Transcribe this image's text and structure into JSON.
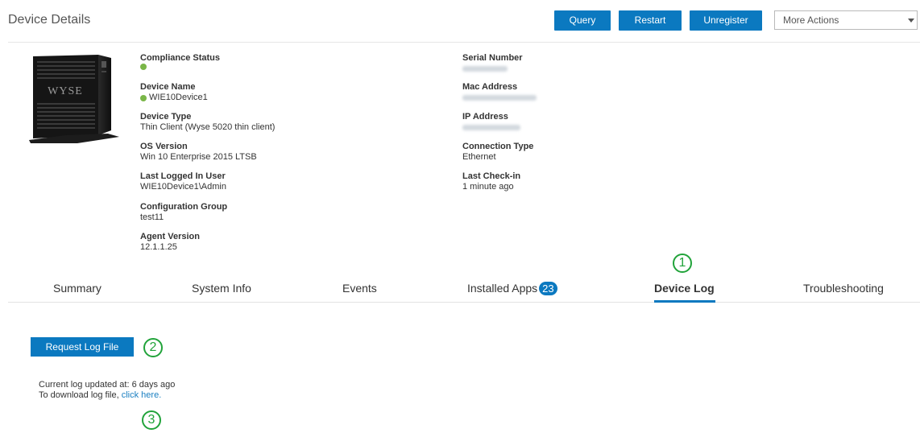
{
  "header": {
    "title": "Device Details",
    "buttons": {
      "query": "Query",
      "restart": "Restart",
      "unregister": "Unregister"
    },
    "more_actions": "More Actions"
  },
  "device": {
    "brand_text": "WYSE",
    "left_fields": [
      {
        "label": "Compliance Status",
        "value": "",
        "status_dot": true
      },
      {
        "label": "Device Name",
        "value": "WIE10Device1",
        "status_dot": true
      },
      {
        "label": "Device Type",
        "value": "Thin Client (Wyse 5020 thin client)"
      },
      {
        "label": "OS Version",
        "value": "Win 10 Enterprise 2015 LTSB"
      },
      {
        "label": "Last Logged In User",
        "value": "WIE10Device1\\Admin"
      },
      {
        "label": "Configuration Group",
        "value": "test11"
      },
      {
        "label": "Agent Version",
        "value": "12.1.1.25"
      }
    ],
    "right_fields": [
      {
        "label": "Serial Number",
        "value": "",
        "redacted": true
      },
      {
        "label": "Mac Address",
        "value": "",
        "redacted": true
      },
      {
        "label": "IP Address",
        "value": "",
        "redacted": true
      },
      {
        "label": "Connection Type",
        "value": "Ethernet"
      },
      {
        "label": "Last Check-in",
        "value": "1 minute ago"
      }
    ]
  },
  "tabs": [
    {
      "label": "Summary"
    },
    {
      "label": "System Info"
    },
    {
      "label": "Events"
    },
    {
      "label": "Installed Apps",
      "badge": "23"
    },
    {
      "label": "Device Log",
      "active": true
    },
    {
      "label": "Troubleshooting"
    }
  ],
  "callouts": {
    "one": "1",
    "two": "2",
    "three": "3"
  },
  "log": {
    "request_button": "Request Log File",
    "updated_text": "Current log updated at: 6 days ago",
    "download_prefix": "To download log file, ",
    "download_link": "click here."
  },
  "colors": {
    "accent": "#0b79c0",
    "status_green": "#7ab648",
    "callout_green": "#21a33a",
    "link": "#1a7fc1"
  }
}
